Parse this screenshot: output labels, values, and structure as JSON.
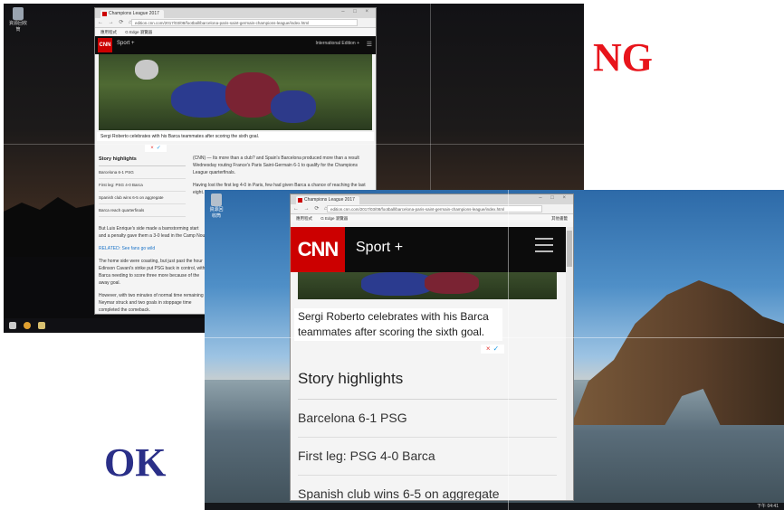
{
  "labels": {
    "ng": "NG",
    "ok": "OK"
  },
  "desktop": {
    "icon_label": "資源回收筒"
  },
  "browser": {
    "tab_title": "Champions League 2017",
    "window_controls": "– □ ×",
    "nav_glyphs": "← → ⟳ ⌂",
    "url": "edition.cnn.com/2017/03/08/football/barcelona-paris-saint-germain-champions-league/index.html",
    "bookmarks": [
      "應用程式",
      "G Edge 瀏覽器"
    ],
    "bookmarks_right": "其他書籤"
  },
  "cnn": {
    "logo": "CNN",
    "section": "Sport +",
    "edition": "International Edition +"
  },
  "article": {
    "caption": "Sergi Roberto celebrates with his Barca teammates after scoring the sixth goal.",
    "highlights_title": "Story highlights",
    "highlights": [
      "Barcelona 6-1 PSG",
      "First leg: PSG 4-0 Barca",
      "Spanish club wins 6-5 on aggregate",
      "Barca reach quarterfinals"
    ],
    "p1": "(CNN) — Its more than a club? and Spain's Barcelona produced more than a result Wednesday routing France's Paris Saint-Germain 6-1 to qualify for the Champions League quarterfinals.",
    "p2": "Having lost the first leg 4-0 in Paris, few had given Barca a chance of reaching the last eight.",
    "p3": "But Luis Enrique's side made a barnstorming start and a penalty gave them a 3-0 lead in the Camp Nou.",
    "related": "RELATED: See fans go wild",
    "p4": "The home side were coasting, but just past the hour Edinson Cavani's strike put PSG back in control, with Barca needing to score three more because of the away goal.",
    "p5": "However, with two minutes of normal time remaining Neymar struck and two goals in stoppage time completed the comeback."
  },
  "verify": {
    "reject": "×",
    "accept": "✓"
  },
  "tray": {
    "clock": "下午 04:41"
  },
  "colors": {
    "ng_label": "#e8141b",
    "ok_label": "#2a2f88",
    "cnn_red": "#cc0000",
    "reject": "#e53935",
    "accept": "#1e9be5"
  }
}
